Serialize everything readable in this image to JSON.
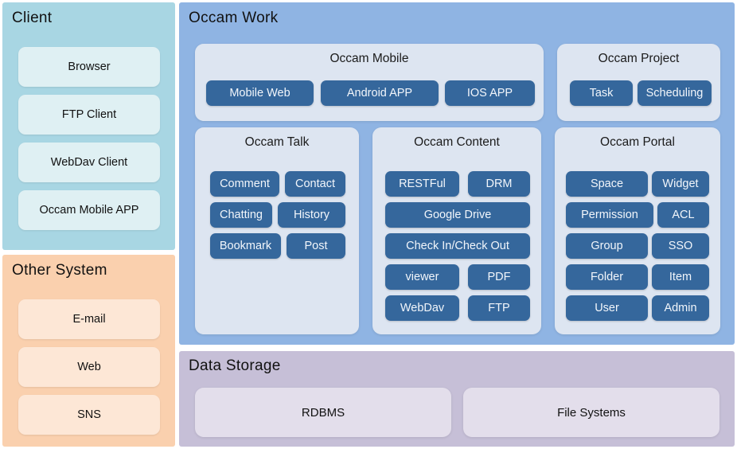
{
  "colors": {
    "client_panel_bg": "#a8d6e3",
    "client_box_bg": "#dff0f3",
    "other_panel_bg": "#fad0ae",
    "other_box_bg": "#fde7d6",
    "work_panel_bg": "#8fb4e3",
    "subpanel_bg": "#dde5f1",
    "pill_bg": "#35679c",
    "storage_panel_bg": "#c6bfd7",
    "storage_box_bg": "#e3deeb",
    "text_dark": "#111111",
    "text_light": "#f2f6fb"
  },
  "client": {
    "title": "Client",
    "items": [
      {
        "label": "Browser"
      },
      {
        "label": "FTP Client"
      },
      {
        "label": "WebDav Client"
      },
      {
        "label": "Occam Mobile APP"
      }
    ]
  },
  "other_system": {
    "title": "Other System",
    "items": [
      {
        "label": "E-mail"
      },
      {
        "label": "Web"
      },
      {
        "label": "SNS"
      }
    ]
  },
  "occam_work": {
    "title": "Occam Work",
    "groups": [
      {
        "title": "Occam Mobile",
        "items": [
          {
            "label": "Mobile Web"
          },
          {
            "label": "Android APP"
          },
          {
            "label": "IOS APP"
          }
        ]
      },
      {
        "title": "Occam Project",
        "items": [
          {
            "label": "Task"
          },
          {
            "label": "Scheduling"
          }
        ]
      },
      {
        "title": "Occam Talk",
        "items": [
          {
            "label": "Comment"
          },
          {
            "label": "Contact"
          },
          {
            "label": "Chatting"
          },
          {
            "label": "History"
          },
          {
            "label": "Bookmark"
          },
          {
            "label": "Post"
          }
        ]
      },
      {
        "title": "Occam Content",
        "items": [
          {
            "label": "RESTFul"
          },
          {
            "label": "DRM"
          },
          {
            "label": "Google Drive"
          },
          {
            "label": "Check In/Check Out"
          },
          {
            "label": "viewer"
          },
          {
            "label": "PDF"
          },
          {
            "label": "WebDav"
          },
          {
            "label": "FTP"
          }
        ]
      },
      {
        "title": "Occam Portal",
        "items": [
          {
            "label": "Space"
          },
          {
            "label": "Widget"
          },
          {
            "label": "Permission"
          },
          {
            "label": "ACL"
          },
          {
            "label": "Group"
          },
          {
            "label": "SSO"
          },
          {
            "label": "Folder"
          },
          {
            "label": "Item"
          },
          {
            "label": "User"
          },
          {
            "label": "Admin"
          }
        ]
      }
    ]
  },
  "data_storage": {
    "title": "Data Storage",
    "items": [
      {
        "label": "RDBMS"
      },
      {
        "label": "File Systems"
      }
    ]
  }
}
